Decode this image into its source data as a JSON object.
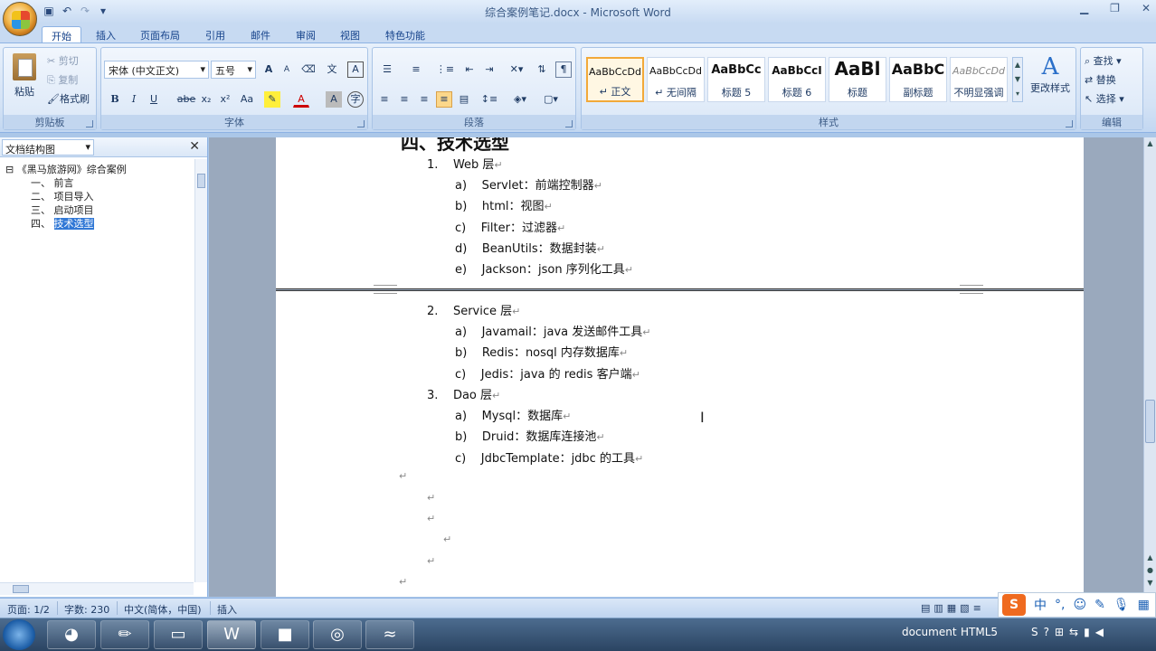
{
  "window": {
    "title": "综合案例笔记.docx - Microsoft Word",
    "minimize_glyph": "▁",
    "restore_glyph": "❐",
    "close_glyph": "✕"
  },
  "ribbon_tabs": [
    "开始",
    "插入",
    "页面布局",
    "引用",
    "邮件",
    "审阅",
    "视图",
    "特色功能"
  ],
  "clipboard": {
    "paste": "粘贴",
    "cut": "剪切",
    "copy": "复制",
    "format_painter": "格式刷",
    "label": "剪贴板"
  },
  "font": {
    "name": "宋体 (中文正文)",
    "size": "五号",
    "label": "字体",
    "bold": "B",
    "italic": "I",
    "underline": "U",
    "strikethrough": "abe",
    "subscript": "x₂",
    "superscript": "x²",
    "change_case": "Aa",
    "grow": "A",
    "shrink": "A",
    "font_color": "A",
    "char_shading": "A",
    "enclose": "字"
  },
  "paragraph": {
    "label": "段落"
  },
  "styles": {
    "label": "样式",
    "items": [
      {
        "sample": "AaBbCcDd",
        "name": "↵ 正文",
        "active": true
      },
      {
        "sample": "AaBbCcDd",
        "name": "↵ 无间隔",
        "active": false
      },
      {
        "sample": "AaBbCc",
        "name": "标题 5",
        "active": false
      },
      {
        "sample": "AaBbCcI",
        "name": "标题 6",
        "active": false
      },
      {
        "sample": "AaBl",
        "name": "标题",
        "active": false
      },
      {
        "sample": "AaBbC",
        "name": "副标题",
        "active": false
      },
      {
        "sample": "AaBbCcDd",
        "name": "不明显强调",
        "active": false
      }
    ],
    "change_styles": "更改样式"
  },
  "editing": {
    "label": "编辑",
    "find": "查找",
    "replace": "替换",
    "select": "选择"
  },
  "nav_pane": {
    "view": "文档结构图",
    "root": "《黑马旅游网》综合案例",
    "items": [
      {
        "num": "一、",
        "text": "前言",
        "selected": false
      },
      {
        "num": "二、",
        "text": "项目导入",
        "selected": false
      },
      {
        "num": "三、",
        "text": "启动项目",
        "selected": false
      },
      {
        "num": "四、",
        "text": "技术选型",
        "selected": true
      }
    ]
  },
  "document": {
    "page1_heading_partial": "四、技术选型",
    "page1": [
      {
        "marker": "1.",
        "text": "Web 层",
        "level": 1
      },
      {
        "marker": "a)",
        "text": "Servlet：前端控制器",
        "level": 2
      },
      {
        "marker": "b)",
        "text": "html：视图",
        "level": 2
      },
      {
        "marker": "c)",
        "text": "Filter：过滤器",
        "level": 2
      },
      {
        "marker": "d)",
        "text": "BeanUtils：数据封装",
        "level": 2
      },
      {
        "marker": "e)",
        "text": "Jackson：json 序列化工具",
        "level": 2
      }
    ],
    "page2": [
      {
        "marker": "2.",
        "text": "Service 层",
        "level": 1
      },
      {
        "marker": "a)",
        "text": "Javamail：java 发送邮件工具",
        "level": 2
      },
      {
        "marker": "b)",
        "text": "Redis：nosql 内存数据库",
        "level": 2
      },
      {
        "marker": "c)",
        "text": "Jedis：java 的 redis 客户端",
        "level": 2
      },
      {
        "marker": "3.",
        "text": "Dao 层",
        "level": 1
      },
      {
        "marker": "a)",
        "text": "Mysql：数据库",
        "level": 2
      },
      {
        "marker": "b)",
        "text": "Druid：数据库连接池",
        "level": 2
      },
      {
        "marker": "c)",
        "text": "JdbcTemplate：jdbc 的工具",
        "level": 2
      }
    ],
    "paragraph_mark": "↵"
  },
  "status_bar": {
    "page": "页面: 1/2",
    "words": "字数: 230",
    "language": "中文(简体，中国)",
    "mode": "插入"
  },
  "ime": {
    "brand": "S",
    "mode": "中",
    "punct": "°,",
    "icons": [
      "smiley-icon",
      "pen-icon",
      "mic-icon",
      "grid-icon"
    ]
  },
  "taskbar": {
    "apps": [
      "paint-icon",
      "pencil-app-icon",
      "explorer-icon",
      "word-icon",
      "intellij-icon",
      "chrome-icon",
      "dolphin-icon"
    ],
    "tray_document": "document",
    "tray_html5": "HTML5"
  }
}
